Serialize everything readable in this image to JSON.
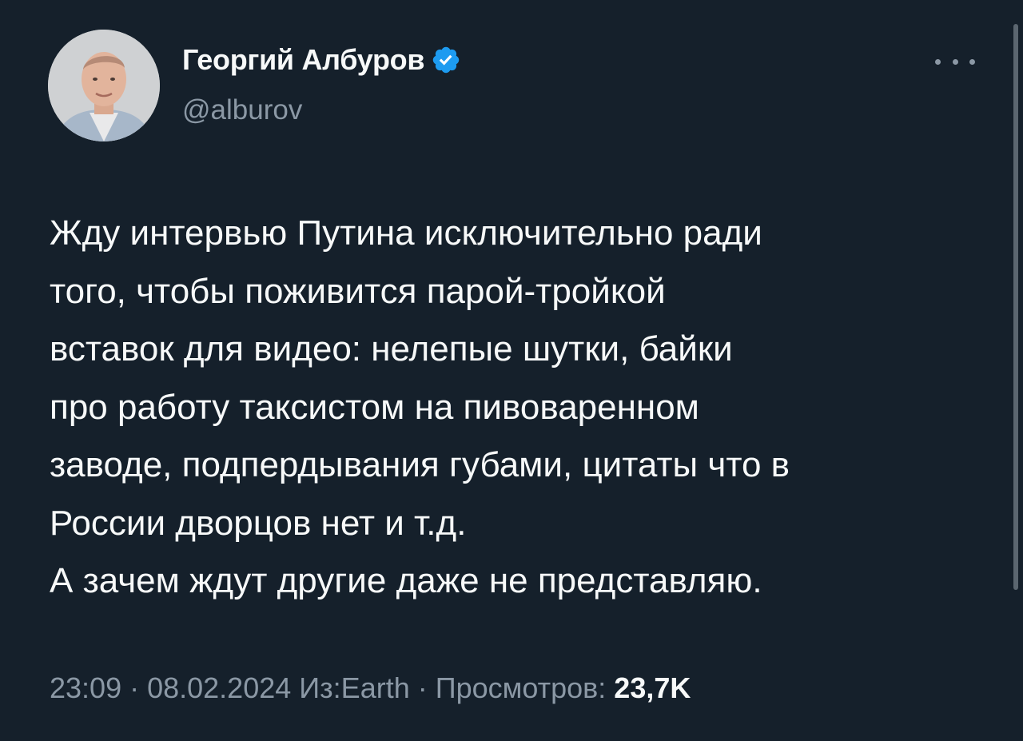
{
  "author": {
    "name": "Георгий Албуров",
    "handle": "@alburov",
    "verified": true,
    "verified_icon": "verified-badge-icon"
  },
  "tweet": {
    "lines": [
      "Жду интервью Путина исключительно ради",
      "того, чтобы поживится парой-тройкой",
      "вставок для видео: нелепые шутки, байки",
      "про работу таксистом на пивоваренном",
      "заводе, подпердывания губами, цитаты что в",
      "России дворцов нет и т.д.",
      "А зачем ждут другие даже не представляю."
    ]
  },
  "meta": {
    "time": "23:09",
    "sep1": " · ",
    "date": "08.02.2024",
    "sep2": " ",
    "source": "Из:Earth",
    "sep3": " · ",
    "views_label": "Просмотров: ",
    "views_count": "23,7K"
  },
  "colors": {
    "background": "#15202b",
    "text_primary": "#f7f9f9",
    "text_secondary": "#8b98a5",
    "verified_blue": "#1d9bf0"
  }
}
